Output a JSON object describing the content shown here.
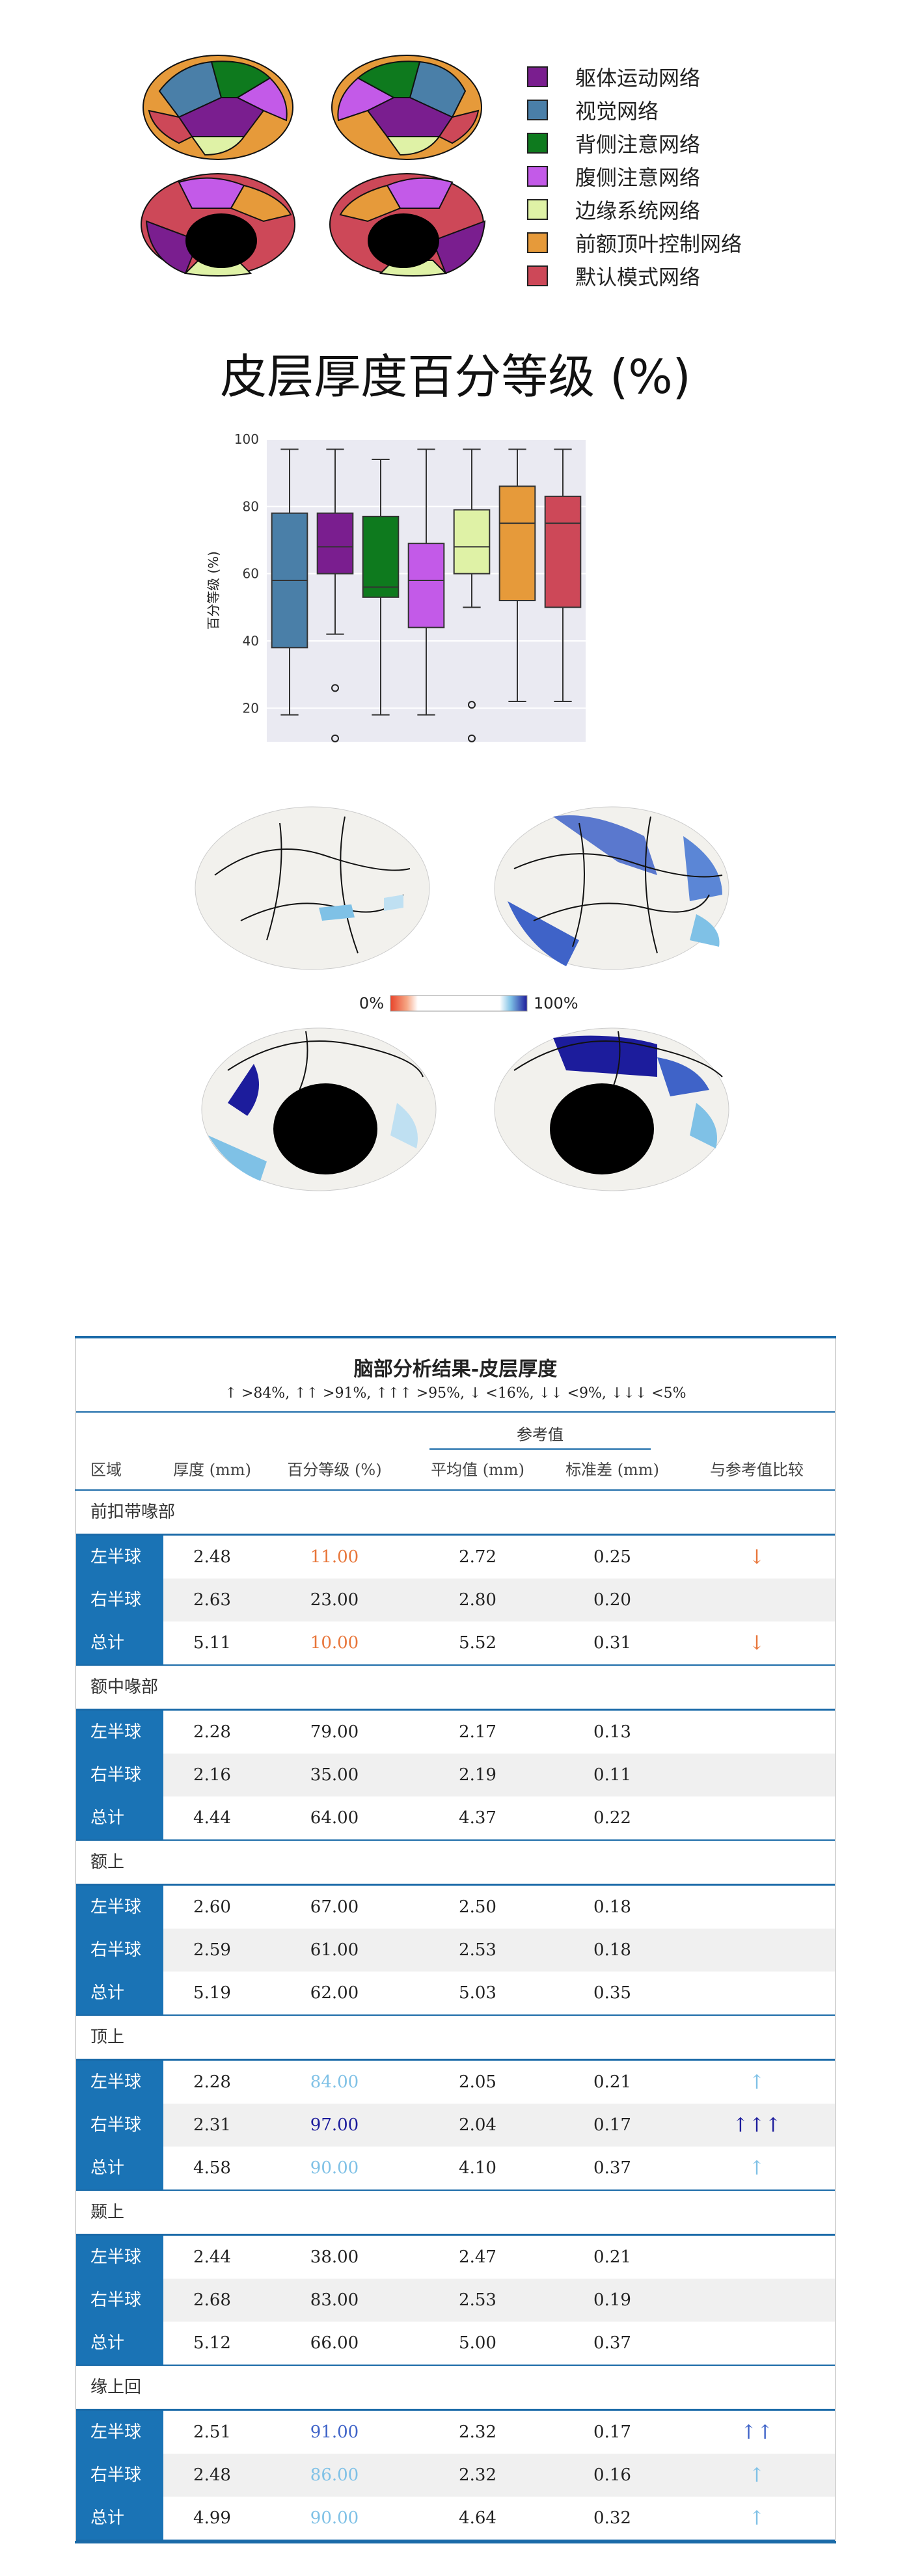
{
  "legend": [
    {
      "label": "躯体运动网络",
      "color": "#7a1e8f"
    },
    {
      "label": "视觉网络",
      "color": "#4a7fa8"
    },
    {
      "label": "背侧注意网络",
      "color": "#0e7a1e"
    },
    {
      "label": "腹侧注意网络",
      "color": "#c35ae8"
    },
    {
      "label": "边缘系统网络",
      "color": "#dff2a6"
    },
    {
      "label": "前额顶叶控制网络",
      "color": "#e69a3a"
    },
    {
      "label": "默认模式网络",
      "color": "#cd4858"
    }
  ],
  "page_title": "皮层厚度百分等级 (%)",
  "chart_data": {
    "type": "box",
    "ylabel": "百分等级 (%)",
    "ylim": [
      10,
      100
    ],
    "yticks": [
      20,
      40,
      60,
      80,
      100
    ],
    "grid": true,
    "series": [
      {
        "color": "#4a7fa8",
        "whisker_low": 18,
        "q1": 38,
        "median": 58,
        "q3": 78,
        "whisker_high": 97,
        "outliers": []
      },
      {
        "color": "#7a1e8f",
        "whisker_low": 42,
        "q1": 60,
        "median": 68,
        "q3": 78,
        "whisker_high": 97,
        "outliers": [
          26,
          11
        ]
      },
      {
        "color": "#0e7a1e",
        "whisker_low": 18,
        "q1": 53,
        "median": 56,
        "q3": 77,
        "whisker_high": 94,
        "outliers": []
      },
      {
        "color": "#c35ae8",
        "whisker_low": 18,
        "q1": 44,
        "median": 58,
        "q3": 69,
        "whisker_high": 97,
        "outliers": []
      },
      {
        "color": "#dff2a6",
        "whisker_low": 50,
        "q1": 60,
        "median": 68,
        "q3": 79,
        "whisker_high": 97,
        "outliers": [
          21,
          11
        ]
      },
      {
        "color": "#e69a3a",
        "whisker_low": 22,
        "q1": 52,
        "median": 75,
        "q3": 86,
        "whisker_high": 97,
        "outliers": []
      },
      {
        "color": "#cd4858",
        "whisker_low": 22,
        "q1": 50,
        "median": 75,
        "q3": 83,
        "whisker_high": 97,
        "outliers": []
      }
    ]
  },
  "colorbar": {
    "min_label": "0%",
    "max_label": "100%"
  },
  "table": {
    "title": "脑部分析结果-皮层厚度",
    "subtitle": "↑ >84%, ↑↑ >91%, ↑↑↑ >95%, ↓ <16%, ↓↓ <9%, ↓↓↓ <5%",
    "ref_header": "参考值",
    "headers": {
      "region": "区域",
      "thickness": "厚度 (mm)",
      "percentile": "百分等级 (%)",
      "mean": "平均值 (mm)",
      "sd": "标准差 (mm)",
      "compare": "与参考值比较"
    },
    "groups": [
      {
        "name": "前扣带喙部",
        "rows": [
          {
            "region": "左半球",
            "thickness": "2.48",
            "percentile": "11.00",
            "pct_color": "#e8763a",
            "mean": "2.72",
            "sd": "0.25",
            "compare": "↓",
            "cmp_color": "#e8763a"
          },
          {
            "region": "右半球",
            "thickness": "2.63",
            "percentile": "23.00",
            "pct_color": "#222222",
            "mean": "2.80",
            "sd": "0.20",
            "compare": "",
            "cmp_color": "#222222"
          },
          {
            "region": "总计",
            "thickness": "5.11",
            "percentile": "10.00",
            "pct_color": "#e8763a",
            "mean": "5.52",
            "sd": "0.31",
            "compare": "↓",
            "cmp_color": "#e8763a"
          }
        ]
      },
      {
        "name": "额中喙部",
        "rows": [
          {
            "region": "左半球",
            "thickness": "2.28",
            "percentile": "79.00",
            "pct_color": "#222222",
            "mean": "2.17",
            "sd": "0.13",
            "compare": "",
            "cmp_color": "#222222"
          },
          {
            "region": "右半球",
            "thickness": "2.16",
            "percentile": "35.00",
            "pct_color": "#222222",
            "mean": "2.19",
            "sd": "0.11",
            "compare": "",
            "cmp_color": "#222222"
          },
          {
            "region": "总计",
            "thickness": "4.44",
            "percentile": "64.00",
            "pct_color": "#222222",
            "mean": "4.37",
            "sd": "0.22",
            "compare": "",
            "cmp_color": "#222222"
          }
        ]
      },
      {
        "name": "额上",
        "rows": [
          {
            "region": "左半球",
            "thickness": "2.60",
            "percentile": "67.00",
            "pct_color": "#222222",
            "mean": "2.50",
            "sd": "0.18",
            "compare": "",
            "cmp_color": "#222222"
          },
          {
            "region": "右半球",
            "thickness": "2.59",
            "percentile": "61.00",
            "pct_color": "#222222",
            "mean": "2.53",
            "sd": "0.18",
            "compare": "",
            "cmp_color": "#222222"
          },
          {
            "region": "总计",
            "thickness": "5.19",
            "percentile": "62.00",
            "pct_color": "#222222",
            "mean": "5.03",
            "sd": "0.35",
            "compare": "",
            "cmp_color": "#222222"
          }
        ]
      },
      {
        "name": "顶上",
        "rows": [
          {
            "region": "左半球",
            "thickness": "2.28",
            "percentile": "84.00",
            "pct_color": "#7fc1e6",
            "mean": "2.05",
            "sd": "0.21",
            "compare": "↑",
            "cmp_color": "#7fc1e6"
          },
          {
            "region": "右半球",
            "thickness": "2.31",
            "percentile": "97.00",
            "pct_color": "#1c1c9c",
            "mean": "2.04",
            "sd": "0.17",
            "compare": "↑↑↑",
            "cmp_color": "#1c1c9c"
          },
          {
            "region": "总计",
            "thickness": "4.58",
            "percentile": "90.00",
            "pct_color": "#7fc1e6",
            "mean": "4.10",
            "sd": "0.37",
            "compare": "↑",
            "cmp_color": "#7fc1e6"
          }
        ]
      },
      {
        "name": "颞上",
        "rows": [
          {
            "region": "左半球",
            "thickness": "2.44",
            "percentile": "38.00",
            "pct_color": "#222222",
            "mean": "2.47",
            "sd": "0.21",
            "compare": "",
            "cmp_color": "#222222"
          },
          {
            "region": "右半球",
            "thickness": "2.68",
            "percentile": "83.00",
            "pct_color": "#222222",
            "mean": "2.53",
            "sd": "0.19",
            "compare": "",
            "cmp_color": "#222222"
          },
          {
            "region": "总计",
            "thickness": "5.12",
            "percentile": "66.00",
            "pct_color": "#222222",
            "mean": "5.00",
            "sd": "0.37",
            "compare": "",
            "cmp_color": "#222222"
          }
        ]
      },
      {
        "name": "缘上回",
        "rows": [
          {
            "region": "左半球",
            "thickness": "2.51",
            "percentile": "91.00",
            "pct_color": "#3f63c8",
            "mean": "2.32",
            "sd": "0.17",
            "compare": "↑↑",
            "cmp_color": "#3f63c8"
          },
          {
            "region": "右半球",
            "thickness": "2.48",
            "percentile": "86.00",
            "pct_color": "#7fc1e6",
            "mean": "2.32",
            "sd": "0.16",
            "compare": "↑",
            "cmp_color": "#7fc1e6"
          },
          {
            "region": "总计",
            "thickness": "4.99",
            "percentile": "90.00",
            "pct_color": "#7fc1e6",
            "mean": "4.64",
            "sd": "0.32",
            "compare": "↑",
            "cmp_color": "#7fc1e6"
          }
        ]
      }
    ]
  }
}
